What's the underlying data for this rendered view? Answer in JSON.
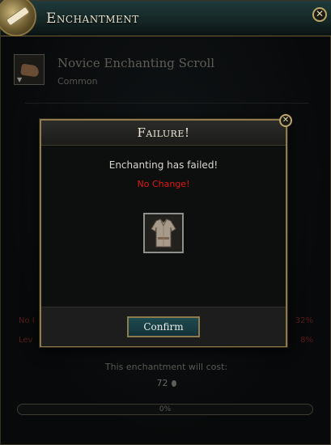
{
  "window": {
    "title": "Enchantment",
    "close_glyph": "✕"
  },
  "item": {
    "name": "Novice Enchanting Scroll",
    "rarity": "Common",
    "icon": "glove-icon"
  },
  "stats": [
    {
      "label": "No I",
      "value": "32%"
    },
    {
      "label": "Lev",
      "value": "8%"
    }
  ],
  "cost": {
    "label": "This enchantment will cost:",
    "value": "72"
  },
  "progress": {
    "text": "0%",
    "fraction": 0
  },
  "modal": {
    "title": "Failure!",
    "message": "Enchanting has failed!",
    "result": "No Change!",
    "result_item_icon": "shirt-icon",
    "confirm_label": "Confirm",
    "close_glyph": "✕"
  },
  "colors": {
    "failure_text": "#e01a14",
    "accent_teal": "#1e4a50",
    "gold_border": "#8f7b4b"
  }
}
